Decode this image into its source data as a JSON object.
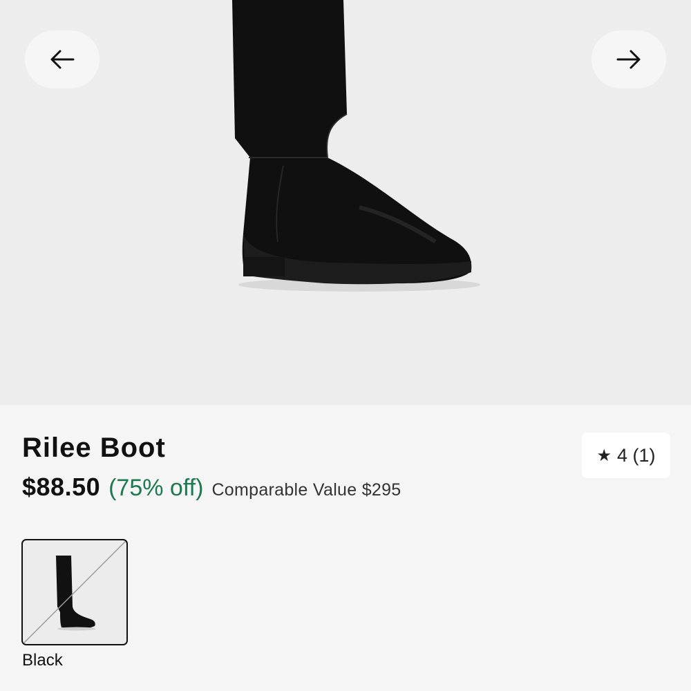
{
  "gallery": {
    "prev_icon": "arrow-left-icon",
    "next_icon": "arrow-right-icon"
  },
  "product": {
    "title": "Rilee Boot",
    "price": "$88.50",
    "discount": "(75% off)",
    "comparable": "Comparable Value $295",
    "rating_text": "4 (1)",
    "rating_icon": "star-icon"
  },
  "colors": {
    "selected": "Black"
  },
  "theme": {
    "discount_color": "#1d7a4f",
    "product_color": "#111111"
  }
}
